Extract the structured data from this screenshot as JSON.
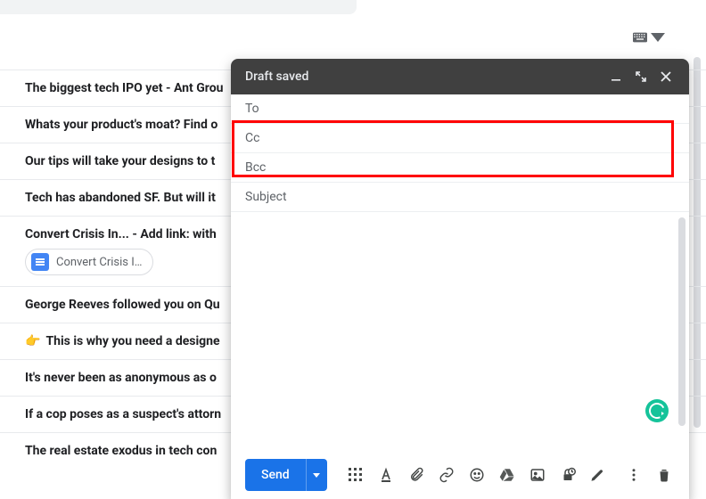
{
  "header": {
    "input_indicator": true
  },
  "emails": [
    {
      "subject": "The biggest tech IPO yet - Ant Grou"
    },
    {
      "subject": "Whats your product's moat? Find o"
    },
    {
      "subject": "Our tips will take your designs to t"
    },
    {
      "subject": "Tech has abandoned SF. But will it"
    },
    {
      "subject": "Convert Crisis In... - Add link: with",
      "chip": "Convert Crisis I…"
    },
    {
      "subject": "George Reeves followed you on Qu"
    },
    {
      "subject": "This is why you need a designe",
      "emoji": "👉"
    },
    {
      "subject": "It's never been as anonymous as o"
    },
    {
      "subject": "If a cop poses as a suspect's attorn"
    },
    {
      "subject": "The real estate exodus in tech con"
    }
  ],
  "compose": {
    "title": "Draft saved",
    "to_label": "To",
    "cc_label": "Cc",
    "bcc_label": "Bcc",
    "subject_placeholder": "Subject",
    "to_value": "",
    "cc_value": "",
    "bcc_value": "",
    "subject_value": "",
    "body_value": "",
    "send_label": "Send"
  },
  "highlight": {
    "target": "cc-bcc-fields"
  }
}
